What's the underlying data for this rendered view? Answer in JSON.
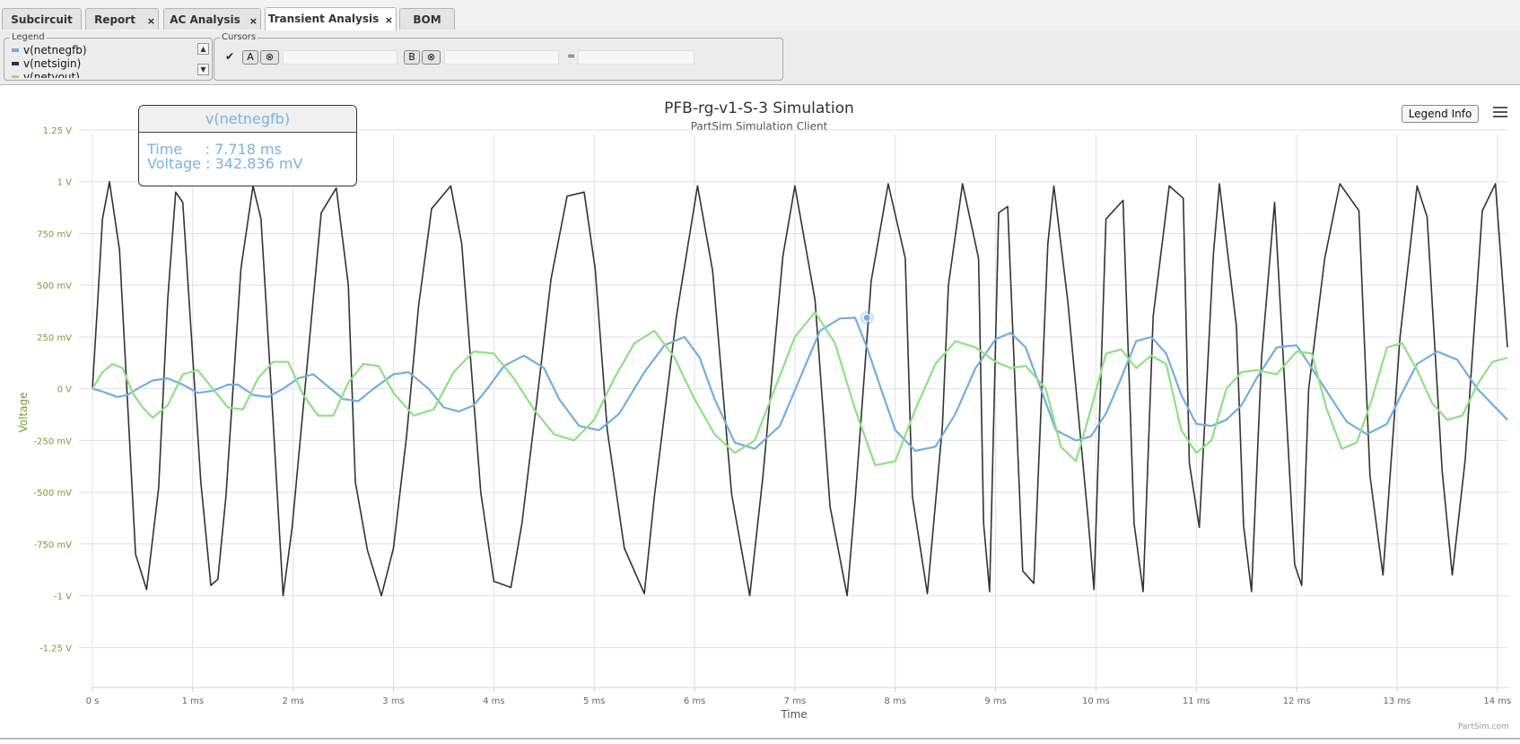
{
  "tabs": [
    {
      "label": "Subcircuit",
      "closable": false,
      "active": false
    },
    {
      "label": "Report",
      "closable": true,
      "active": false
    },
    {
      "label": "AC Analysis",
      "closable": true,
      "active": false
    },
    {
      "label": "Transient Analysis",
      "closable": true,
      "active": true
    },
    {
      "label": "BOM",
      "closable": false,
      "active": false
    }
  ],
  "close_glyph": "×",
  "legend_panel": {
    "title": "Legend",
    "items": [
      {
        "label": "v(netnegfb)",
        "color": "#74aee0"
      },
      {
        "label": "v(netsigin)",
        "color": "#333333"
      },
      {
        "label": "v(netvout)",
        "color": "#90e085"
      }
    ]
  },
  "cursors_panel": {
    "title": "Cursors",
    "checkbox_glyph": "✔",
    "a_label": "A",
    "b_label": "B",
    "clear_glyph": "⊗",
    "equals": "="
  },
  "chart_data": {
    "type": "line",
    "title": "PFB-rg-v1-S-3 Simulation",
    "subtitle": "PartSim Simulation Client",
    "xlabel": "Time",
    "ylabel": "Voltage",
    "xlim": [
      0,
      14.1
    ],
    "ylim": [
      -1.4,
      1.25
    ],
    "x_unit": "ms",
    "y_unit": "V",
    "x_ticks": [
      {
        "v": 0,
        "label": "0 s"
      },
      {
        "v": 1,
        "label": "1 ms"
      },
      {
        "v": 2,
        "label": "2 ms"
      },
      {
        "v": 3,
        "label": "3 ms"
      },
      {
        "v": 4,
        "label": "4 ms"
      },
      {
        "v": 5,
        "label": "5 ms"
      },
      {
        "v": 6,
        "label": "6 ms"
      },
      {
        "v": 7,
        "label": "7 ms"
      },
      {
        "v": 8,
        "label": "8 ms"
      },
      {
        "v": 9,
        "label": "9 ms"
      },
      {
        "v": 10,
        "label": "10 ms"
      },
      {
        "v": 11,
        "label": "11 ms"
      },
      {
        "v": 12,
        "label": "12 ms"
      },
      {
        "v": 13,
        "label": "13 ms"
      },
      {
        "v": 14,
        "label": "14 ms"
      }
    ],
    "y_ticks": [
      {
        "v": 1.25,
        "label": "1.25 V"
      },
      {
        "v": 1.0,
        "label": "1 V"
      },
      {
        "v": 0.75,
        "label": "750 mV"
      },
      {
        "v": 0.5,
        "label": "500 mV"
      },
      {
        "v": 0.25,
        "label": "250 mV"
      },
      {
        "v": 0,
        "label": "0 V"
      },
      {
        "v": -0.25,
        "label": "-250 mV"
      },
      {
        "v": -0.5,
        "label": "-500 mV"
      },
      {
        "v": -0.75,
        "label": "-750 mV"
      },
      {
        "v": -1.0,
        "label": "-1 V"
      },
      {
        "v": -1.25,
        "label": "-1.25 V"
      }
    ],
    "grid": true,
    "series": [
      {
        "name": "v(netsigin)",
        "color": "#333333",
        "x": [
          0.0,
          0.05,
          0.1,
          0.17,
          0.27,
          0.43,
          0.54,
          0.66,
          0.75,
          0.83,
          0.9,
          1.08,
          1.18,
          1.25,
          1.33,
          1.48,
          1.6,
          1.68,
          1.8,
          1.9,
          1.99,
          2.08,
          2.28,
          2.43,
          2.55,
          2.62,
          2.74,
          2.88,
          3.0,
          3.13,
          3.25,
          3.38,
          3.57,
          3.68,
          3.87,
          4.0,
          4.17,
          4.28,
          4.45,
          4.57,
          4.73,
          4.9,
          5.01,
          5.13,
          5.3,
          5.5,
          5.6,
          5.82,
          6.03,
          6.18,
          6.37,
          6.55,
          6.68,
          6.88,
          7.0,
          7.2,
          7.35,
          7.52,
          7.6,
          7.76,
          7.93,
          8.1,
          8.17,
          8.32,
          8.47,
          8.53,
          8.67,
          8.83,
          8.88,
          8.94,
          9.03,
          9.12,
          9.27,
          9.38,
          9.52,
          9.58,
          9.72,
          9.92,
          9.98,
          10.1,
          10.27,
          10.38,
          10.47,
          10.57,
          10.73,
          10.87,
          10.93,
          11.03,
          11.17,
          11.23,
          11.4,
          11.47,
          11.55,
          11.65,
          11.78,
          11.98,
          12.05,
          12.12,
          12.28,
          12.43,
          12.62,
          12.73,
          12.86,
          13.03,
          13.2,
          13.3,
          13.45,
          13.55,
          13.68,
          13.85,
          13.98,
          14.1
        ],
        "y": [
          0.0,
          0.4,
          0.82,
          1.0,
          0.67,
          -0.8,
          -0.97,
          -0.48,
          0.43,
          0.95,
          0.9,
          -0.45,
          -0.95,
          -0.92,
          -0.52,
          0.58,
          0.98,
          0.82,
          -0.15,
          -1.0,
          -0.67,
          -0.2,
          0.85,
          0.97,
          0.5,
          -0.45,
          -0.78,
          -1.0,
          -0.77,
          -0.23,
          0.4,
          0.87,
          0.98,
          0.7,
          -0.5,
          -0.93,
          -0.96,
          -0.65,
          0.03,
          0.53,
          0.93,
          0.95,
          0.58,
          -0.2,
          -0.77,
          -0.99,
          -0.52,
          0.35,
          0.98,
          0.57,
          -0.51,
          -1.0,
          -0.43,
          0.64,
          0.98,
          0.43,
          -0.57,
          -1.0,
          -0.54,
          0.52,
          0.99,
          0.63,
          -0.52,
          -0.99,
          -0.18,
          0.5,
          0.99,
          0.63,
          -0.65,
          -0.98,
          0.85,
          0.88,
          -0.88,
          -0.94,
          0.7,
          0.98,
          0.42,
          -0.62,
          -0.97,
          0.82,
          0.91,
          -0.65,
          -0.98,
          0.35,
          0.98,
          0.92,
          -0.36,
          -0.67,
          0.65,
          0.99,
          0.3,
          -0.66,
          -0.98,
          0.15,
          0.9,
          -0.85,
          -0.95,
          0.0,
          0.63,
          0.99,
          0.86,
          -0.42,
          -0.9,
          0.25,
          0.98,
          0.83,
          -0.4,
          -0.9,
          -0.34,
          0.86,
          0.99,
          0.2
        ]
      },
      {
        "name": "v(netnegfb)",
        "color": "#74aee0",
        "x": [
          0.0,
          0.08,
          0.25,
          0.35,
          0.45,
          0.6,
          0.75,
          0.9,
          1.05,
          1.2,
          1.35,
          1.45,
          1.6,
          1.75,
          1.9,
          2.05,
          2.2,
          2.35,
          2.5,
          2.65,
          2.8,
          3.0,
          3.15,
          3.35,
          3.5,
          3.65,
          3.8,
          3.95,
          4.1,
          4.3,
          4.5,
          4.65,
          4.85,
          5.05,
          5.25,
          5.5,
          5.7,
          5.9,
          6.05,
          6.2,
          6.4,
          6.6,
          6.85,
          7.05,
          7.25,
          7.45,
          7.6,
          7.718,
          7.85,
          8.0,
          8.2,
          8.4,
          8.6,
          8.8,
          9.0,
          9.15,
          9.3,
          9.45,
          9.6,
          9.8,
          9.95,
          10.1,
          10.25,
          10.4,
          10.55,
          10.7,
          10.85,
          11.0,
          11.15,
          11.3,
          11.45,
          11.6,
          11.8,
          12.0,
          12.15,
          12.35,
          12.5,
          12.7,
          12.9,
          13.05,
          13.2,
          13.4,
          13.6,
          13.8,
          14.0,
          14.1
        ],
        "y": [
          0.0,
          -0.01,
          -0.04,
          -0.03,
          0.0,
          0.04,
          0.05,
          0.02,
          -0.02,
          -0.01,
          0.02,
          0.02,
          -0.03,
          -0.04,
          0.0,
          0.05,
          0.07,
          0.01,
          -0.05,
          -0.06,
          0.0,
          0.07,
          0.08,
          0.0,
          -0.09,
          -0.11,
          -0.08,
          0.01,
          0.11,
          0.16,
          0.1,
          -0.05,
          -0.18,
          -0.2,
          -0.12,
          0.08,
          0.21,
          0.25,
          0.15,
          -0.05,
          -0.26,
          -0.29,
          -0.18,
          0.05,
          0.28,
          0.34,
          0.342836,
          0.2,
          0.01,
          -0.2,
          -0.3,
          -0.28,
          -0.12,
          0.1,
          0.24,
          0.27,
          0.2,
          0.0,
          -0.2,
          -0.25,
          -0.23,
          -0.12,
          0.05,
          0.23,
          0.25,
          0.17,
          -0.03,
          -0.17,
          -0.18,
          -0.15,
          -0.08,
          0.05,
          0.2,
          0.21,
          0.1,
          -0.05,
          -0.16,
          -0.22,
          -0.17,
          -0.02,
          0.12,
          0.18,
          0.14,
          0.0,
          -0.1,
          -0.15
        ]
      },
      {
        "name": "v(netvout)",
        "color": "#90e085",
        "x": [
          0.0,
          0.1,
          0.2,
          0.3,
          0.4,
          0.5,
          0.6,
          0.75,
          0.9,
          1.05,
          1.2,
          1.35,
          1.5,
          1.65,
          1.8,
          1.95,
          2.1,
          2.25,
          2.4,
          2.55,
          2.7,
          2.85,
          3.0,
          3.2,
          3.4,
          3.6,
          3.8,
          4.0,
          4.2,
          4.4,
          4.6,
          4.8,
          5.0,
          5.2,
          5.4,
          5.6,
          5.8,
          6.0,
          6.2,
          6.4,
          6.6,
          6.8,
          7.0,
          7.2,
          7.4,
          7.6,
          7.8,
          8.0,
          8.2,
          8.4,
          8.6,
          8.8,
          9.0,
          9.15,
          9.3,
          9.5,
          9.65,
          9.8,
          9.95,
          10.1,
          10.25,
          10.4,
          10.55,
          10.7,
          10.85,
          11.0,
          11.15,
          11.3,
          11.45,
          11.6,
          11.8,
          12.0,
          12.15,
          12.3,
          12.45,
          12.6,
          12.75,
          12.9,
          13.05,
          13.2,
          13.35,
          13.5,
          13.65,
          13.8,
          13.95,
          14.1
        ],
        "y": [
          0.0,
          0.08,
          0.12,
          0.1,
          -0.02,
          -0.09,
          -0.14,
          -0.08,
          0.07,
          0.09,
          0.0,
          -0.09,
          -0.1,
          0.05,
          0.13,
          0.13,
          -0.03,
          -0.13,
          -0.13,
          0.03,
          0.12,
          0.11,
          -0.02,
          -0.13,
          -0.1,
          0.08,
          0.18,
          0.17,
          0.05,
          -0.1,
          -0.22,
          -0.25,
          -0.15,
          0.05,
          0.22,
          0.28,
          0.15,
          -0.05,
          -0.22,
          -0.31,
          -0.25,
          0.0,
          0.25,
          0.37,
          0.22,
          -0.1,
          -0.37,
          -0.35,
          -0.1,
          0.12,
          0.23,
          0.2,
          0.13,
          0.1,
          0.11,
          0.0,
          -0.28,
          -0.35,
          -0.1,
          0.17,
          0.19,
          0.1,
          0.16,
          0.12,
          -0.2,
          -0.31,
          -0.25,
          0.0,
          0.08,
          0.09,
          0.07,
          0.18,
          0.17,
          -0.1,
          -0.29,
          -0.26,
          -0.05,
          0.2,
          0.22,
          0.09,
          -0.07,
          -0.15,
          -0.13,
          0.02,
          0.13,
          0.15
        ]
      }
    ],
    "marker": {
      "series": "v(netnegfb)",
      "x": 7.718,
      "y": 0.342836
    }
  },
  "tooltip": {
    "series": "v(netnegfb)",
    "time_line": "Time     : 7.718 ms",
    "voltage_line": "Voltage : 342.836 mV"
  },
  "legend_info_label": "Legend Info",
  "credit": "PartSim.com"
}
